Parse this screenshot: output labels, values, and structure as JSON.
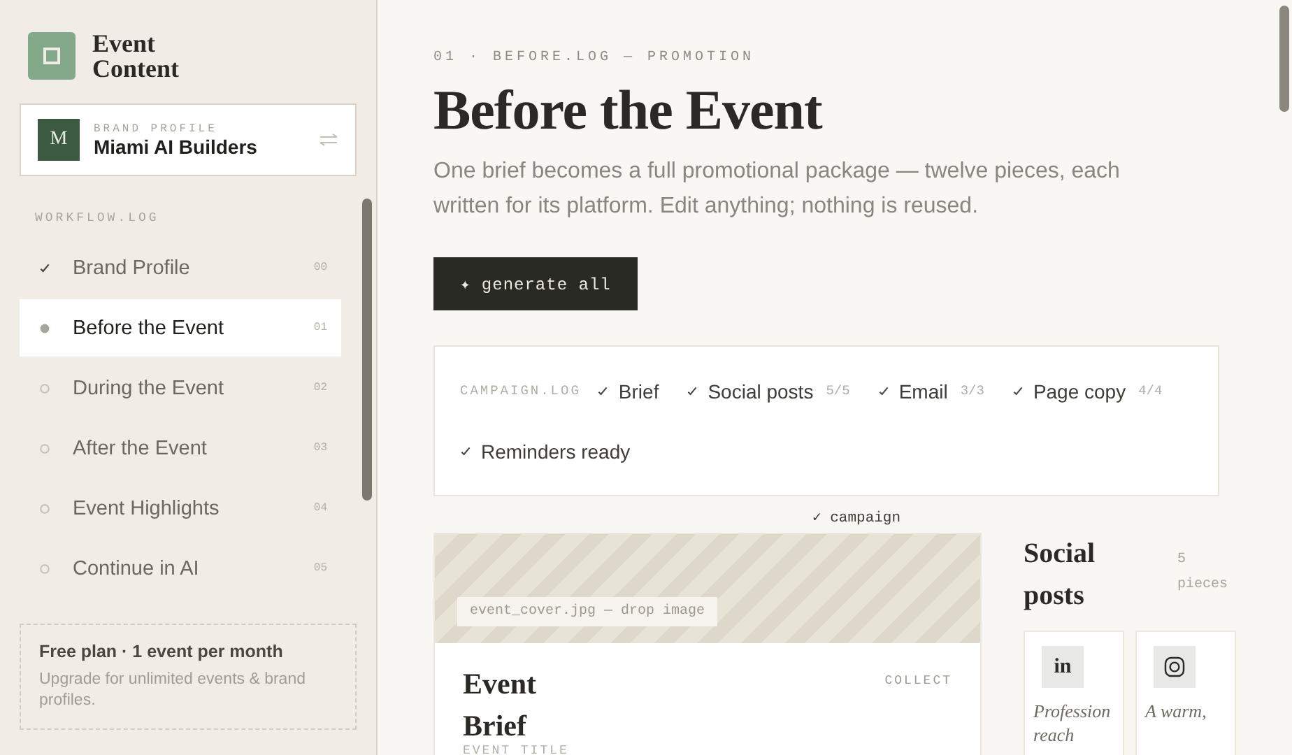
{
  "app": {
    "name": "Event Content"
  },
  "brand_profile": {
    "initial": "M",
    "label": "BRAND PROFILE",
    "name": "Miami AI Builders"
  },
  "sidebar": {
    "heading": "WORKFLOW.LOG",
    "items": [
      {
        "label": "Brand Profile",
        "number": "00",
        "kind": "done",
        "selected": false
      },
      {
        "label": "Before the Event",
        "number": "01",
        "kind": "current",
        "selected": true
      },
      {
        "label": "During the Event",
        "number": "02",
        "kind": "todo",
        "selected": false
      },
      {
        "label": "After the Event",
        "number": "03",
        "kind": "todo",
        "selected": false
      },
      {
        "label": "Event Highlights",
        "number": "04",
        "kind": "todo",
        "selected": false
      },
      {
        "label": "Continue in AI",
        "number": "05",
        "kind": "todo",
        "selected": false
      }
    ]
  },
  "plan": {
    "title": "Free plan · 1 event per month",
    "text": "Upgrade for unlimited events & brand profiles."
  },
  "page": {
    "breadcrumb": "01 · BEFORE.LOG — PROMOTION",
    "title": "Before the Event",
    "description": "One brief becomes a full promotional package — twelve pieces, each written for its platform. Edit anything; nothing is reused.",
    "button": "✦ generate all"
  },
  "campaign_log": {
    "label": "CAMPAIGN.LOG",
    "items": [
      {
        "label": "Brief",
        "done": true
      },
      {
        "label": "Social posts",
        "count": "5/5",
        "done": true
      },
      {
        "label": "Email",
        "count": "3/3",
        "done": true
      },
      {
        "label": "Page copy",
        "count": "4/4",
        "done": true
      },
      {
        "label": "Reminders ready",
        "done": true
      }
    ],
    "status": "✓ campaign"
  },
  "brief": {
    "image_hint": "event_cover.jpg — drop image",
    "title": "Event Brief",
    "action": "COLLECT",
    "field_label": "EVENT TITLE"
  },
  "social": {
    "title": "Social posts",
    "count": "5 pieces",
    "cards": [
      {
        "kind": "linkedin",
        "glyph": "in",
        "text": "Profession reach"
      },
      {
        "kind": "instagram",
        "text": "A warm,"
      }
    ]
  }
}
